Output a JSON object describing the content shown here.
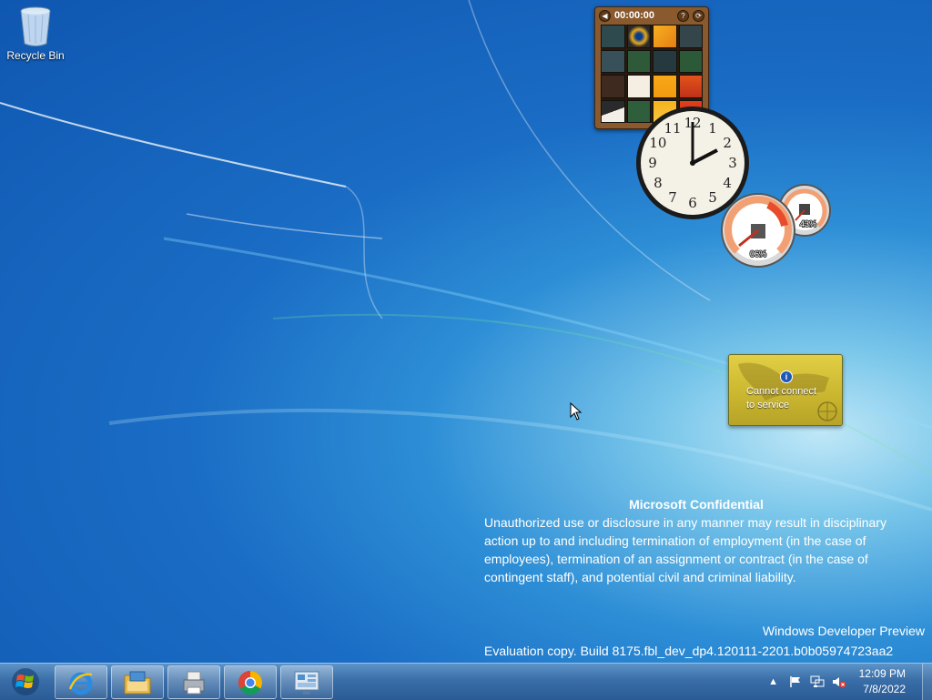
{
  "desktop": {
    "icons": [
      {
        "label": "Recycle Bin",
        "icon": "recycle-bin-icon"
      }
    ]
  },
  "gadgets": {
    "puzzle": {
      "timer": "00:00:00",
      "help": "?",
      "shuffle": "⟳",
      "back": "◀"
    },
    "clock": {
      "numerals": [
        "12",
        "1",
        "2",
        "3",
        "4",
        "5",
        "6",
        "7",
        "8",
        "9",
        "10",
        "11"
      ]
    },
    "cpu_meter": {
      "cpu_percent": "06%",
      "memory_percent": "43%",
      "cpu_value": 6,
      "memory_value": 43
    },
    "weather": {
      "message_line1": "Cannot connect",
      "message_line2": "to service",
      "info": "i"
    }
  },
  "watermark": {
    "title": "Microsoft Confidential",
    "body": "Unauthorized use or disclosure in any manner may result in disciplinary action up to and including termination of employment (in the case of employees), termination of an assignment or contract (in the case of contingent staff), and potential civil and criminal liability.",
    "edition": "Windows Developer Preview",
    "build": "Evaluation copy. Build 8175.fbl_dev_dp4.120111-2201.b0b05974723aa2"
  },
  "taskbar": {
    "start": "start-button",
    "pinned": [
      {
        "name": "internet-explorer",
        "icon": "internet-explorer-icon"
      },
      {
        "name": "windows-explorer",
        "icon": "folder-icon"
      },
      {
        "name": "printer-app",
        "icon": "printer-icon"
      },
      {
        "name": "chrome",
        "icon": "chrome-icon"
      },
      {
        "name": "control-panel",
        "icon": "control-panel-icon"
      }
    ],
    "tray": {
      "time": "12:09 PM",
      "date": "7/8/2022",
      "icons": [
        "show-hidden-icons",
        "action-center-flag-icon",
        "network-icon",
        "volume-muted-icon"
      ]
    }
  }
}
